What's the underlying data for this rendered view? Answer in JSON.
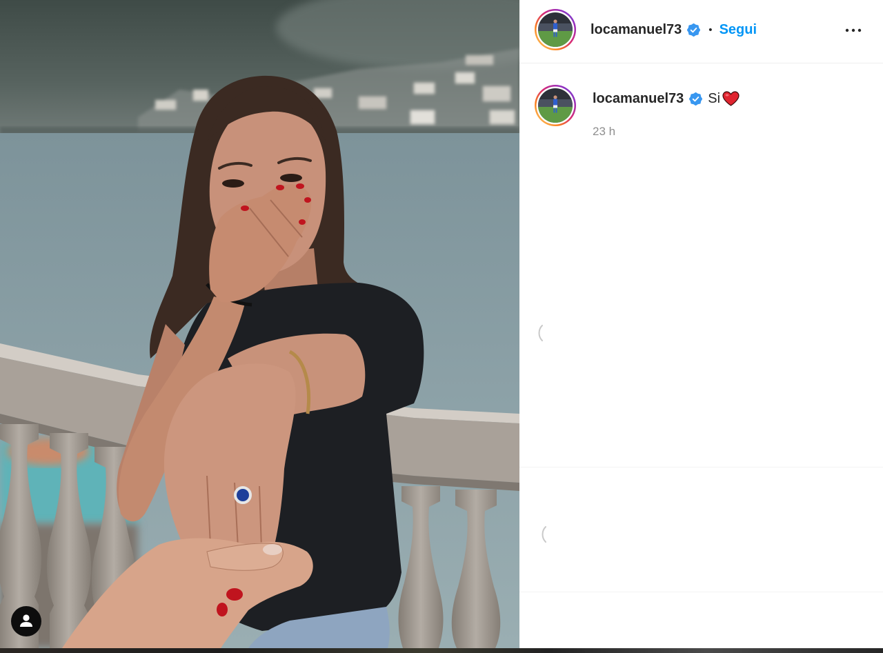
{
  "post_header": {
    "username": "locamanuel73",
    "verified_icon": "verified-badge-icon",
    "separator": "•",
    "follow_label": "Segui",
    "more_icon": "more-options-icon",
    "avatar_icon": "profile-avatar"
  },
  "caption": {
    "username": "locamanuel73",
    "verified_icon": "verified-badge-icon",
    "text": "Si",
    "emoji_icon": "red-heart-icon",
    "timestamp": "23 h"
  },
  "photo": {
    "tag_icon": "user-tag-icon"
  },
  "colors": {
    "follow_accent": "#0095f6",
    "verified_badge": "#3897f0",
    "primary_text": "#262626",
    "secondary_text": "#8e8e8e",
    "heart": "#e0242f",
    "divider": "#efefef"
  }
}
